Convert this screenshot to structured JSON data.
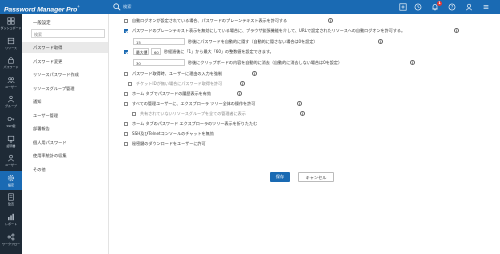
{
  "app": {
    "brand": "Password Manager Pro",
    "brand_sup": "+"
  },
  "topbar": {
    "search_placeholder": "検索",
    "notification_count": "1"
  },
  "leftnav": [
    {
      "label": "ダッシュボード",
      "icon": "dashboard-icon"
    },
    {
      "label": "リソース",
      "icon": "resources-icon"
    },
    {
      "label": "パスワード",
      "icon": "password-icon"
    },
    {
      "label": "ユーザー",
      "icon": "users-icon"
    },
    {
      "label": "グループ",
      "icon": "groups-icon"
    },
    {
      "label": "SSH鍵",
      "icon": "ssh-key-icon"
    },
    {
      "label": "証明書",
      "icon": "certificate-icon"
    },
    {
      "label": "ユーザー",
      "icon": "user-icon"
    },
    {
      "label": "設定",
      "icon": "settings-icon"
    },
    {
      "label": "監査",
      "icon": "audit-icon"
    },
    {
      "label": "レポート",
      "icon": "reports-icon"
    },
    {
      "label": "ワークフロー",
      "icon": "workflow-icon"
    }
  ],
  "settings": {
    "title": "一般設定",
    "filter_placeholder": "検索",
    "items": [
      "パスワード取得",
      "パスワード変更",
      "リソースパスワード作成",
      "リソースグループ管理",
      "通知",
      "ユーザー管理",
      "部署報告",
      "個人用パスワード",
      "使用率統計の収集",
      "その他"
    ]
  },
  "options": [
    {
      "label": "自動ログオンが設定されている場合、パスワードのプレーンテキスト表示を許可する",
      "checked": false
    },
    {
      "label": "パスワードのプレーンテキスト表示を無効にしている場合に、ブラウザ拡張機能を介して、URLで設定されたリソースへの自動ログオンを許可する。",
      "checked": true
    },
    {
      "prefix": "",
      "value": "15",
      "label": "秒後にパスワードを自動的に隠す（自動的に隠さない場合は0を設定）"
    },
    {
      "prefix": "最大値",
      "value": "60",
      "label": "秒経過後に「1」から最大「60」の整数値を設定できます。"
    },
    {
      "prefix": "",
      "value": "30",
      "label": "秒後にクリップボードの内容を自動的に消去（自動的に消去しない場合は0を設定）"
    },
    {
      "label": "パスワード取得時、ユーザーに理由の入力を強制",
      "checked": false
    },
    {
      "label": "チケットIDが無い場合にパスワード取得を許可",
      "checked": false,
      "disabled": true
    },
    {
      "label": "ホーム タブでパスワードの履歴表示を有効",
      "checked": false
    },
    {
      "label": "すべての管理ユーザーに、エクスプローラ ツリー全体の操作を許可",
      "checked": false
    },
    {
      "label": "共有されていないリソースグループを全ての管理者に表示",
      "checked": false,
      "disabled": true
    },
    {
      "label": "ホーム タブのパスワード エクスプローラのツリー表示を折りたたむ",
      "checked": false
    },
    {
      "label": "SSH及びTelnetコンソールのチャットを無効",
      "checked": false
    },
    {
      "label": "秘密鍵のダウンロードをユーザーに許可",
      "checked": false
    }
  ],
  "buttons": {
    "save": "保存",
    "cancel": "キャンセル"
  },
  "colors": {
    "accent": "#1a6ab3",
    "nav_bg": "#1e2a36"
  }
}
